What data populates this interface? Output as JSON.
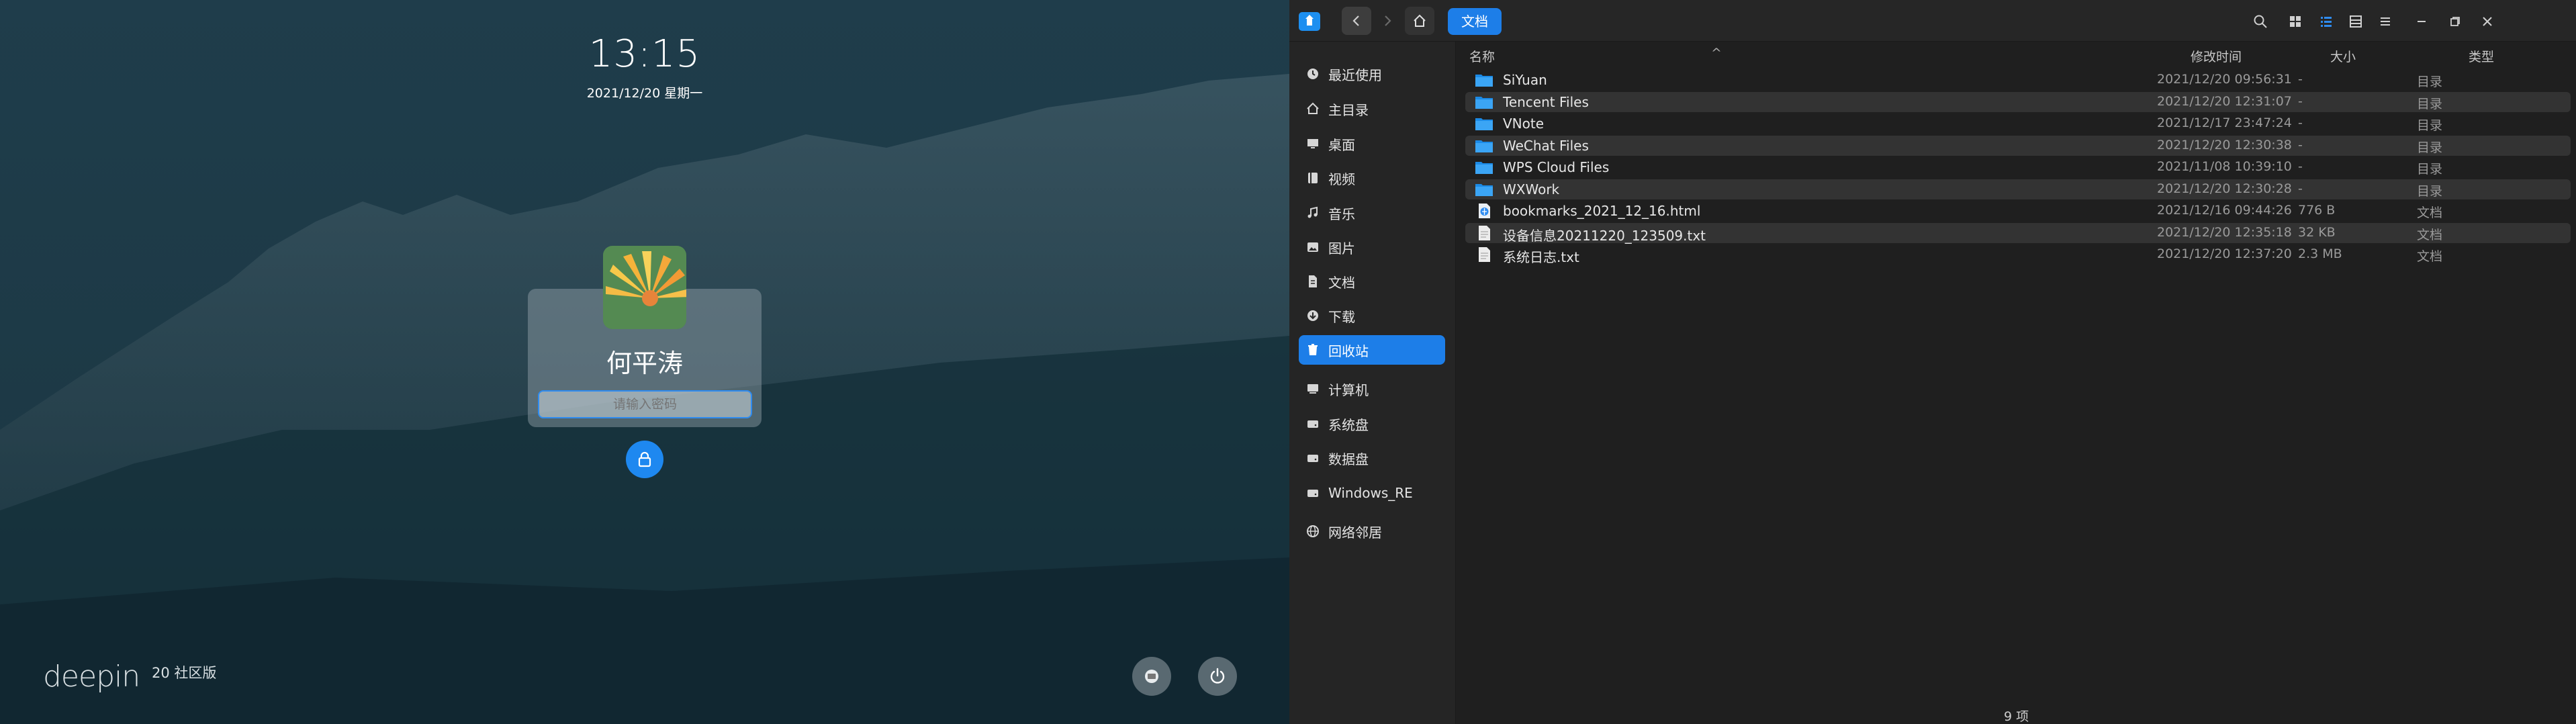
{
  "lock_screen": {
    "time": "13:15",
    "date": "2021/12/20 星期一",
    "user_name": "何平涛",
    "password_placeholder": "请输入密码",
    "brand": "deepin",
    "edition": "20 社区版"
  },
  "file_manager": {
    "breadcrumb": "文档",
    "sidebar": [
      {
        "label": "最近使用",
        "icon": "clock-icon",
        "active": false
      },
      {
        "label": "主目录",
        "icon": "home-icon",
        "active": false
      },
      {
        "label": "桌面",
        "icon": "desktop-icon",
        "active": false
      },
      {
        "label": "视频",
        "icon": "video-icon",
        "active": false
      },
      {
        "label": "音乐",
        "icon": "music-icon",
        "active": false
      },
      {
        "label": "图片",
        "icon": "picture-icon",
        "active": false
      },
      {
        "label": "文档",
        "icon": "document-icon",
        "active": false
      },
      {
        "label": "下载",
        "icon": "download-icon",
        "active": false
      },
      {
        "label": "回收站",
        "icon": "trash-icon",
        "active": true
      },
      {
        "label": "计算机",
        "icon": "computer-icon",
        "active": false
      },
      {
        "label": "系统盘",
        "icon": "disk-icon",
        "active": false
      },
      {
        "label": "数据盘",
        "icon": "disk-icon",
        "active": false
      },
      {
        "label": "Windows_RE",
        "icon": "disk-icon",
        "active": false
      },
      {
        "label": "网络邻居",
        "icon": "network-icon",
        "active": false
      }
    ],
    "columns": {
      "name": "名称",
      "modified": "修改时间",
      "size": "大小",
      "type": "类型"
    },
    "files": [
      {
        "name": "SiYuan",
        "modified": "2021/12/20 09:56:31",
        "size": "-",
        "type": "目录",
        "icon": "folder-icon"
      },
      {
        "name": "Tencent Files",
        "modified": "2021/12/20 12:31:07",
        "size": "-",
        "type": "目录",
        "icon": "folder-icon"
      },
      {
        "name": "VNote",
        "modified": "2021/12/17 23:47:24",
        "size": "-",
        "type": "目录",
        "icon": "folder-icon"
      },
      {
        "name": "WeChat Files",
        "modified": "2021/12/20 12:30:38",
        "size": "-",
        "type": "目录",
        "icon": "folder-icon"
      },
      {
        "name": "WPS Cloud Files",
        "modified": "2021/11/08 10:39:10",
        "size": "-",
        "type": "目录",
        "icon": "folder-icon"
      },
      {
        "name": "WXWork",
        "modified": "2021/12/20 12:30:28",
        "size": "-",
        "type": "目录",
        "icon": "folder-icon"
      },
      {
        "name": "bookmarks_2021_12_16.html",
        "modified": "2021/12/16 09:44:26",
        "size": "776 B",
        "type": "文档",
        "icon": "html-file-icon"
      },
      {
        "name": "设备信息20211220_123509.txt",
        "modified": "2021/12/20 12:35:18",
        "size": "32 KB",
        "type": "文档",
        "icon": "text-file-icon"
      },
      {
        "name": "系统日志.txt",
        "modified": "2021/12/20 12:37:20",
        "size": "2.3 MB",
        "type": "文档",
        "icon": "text-file-icon"
      }
    ],
    "item_count": "9 项"
  }
}
